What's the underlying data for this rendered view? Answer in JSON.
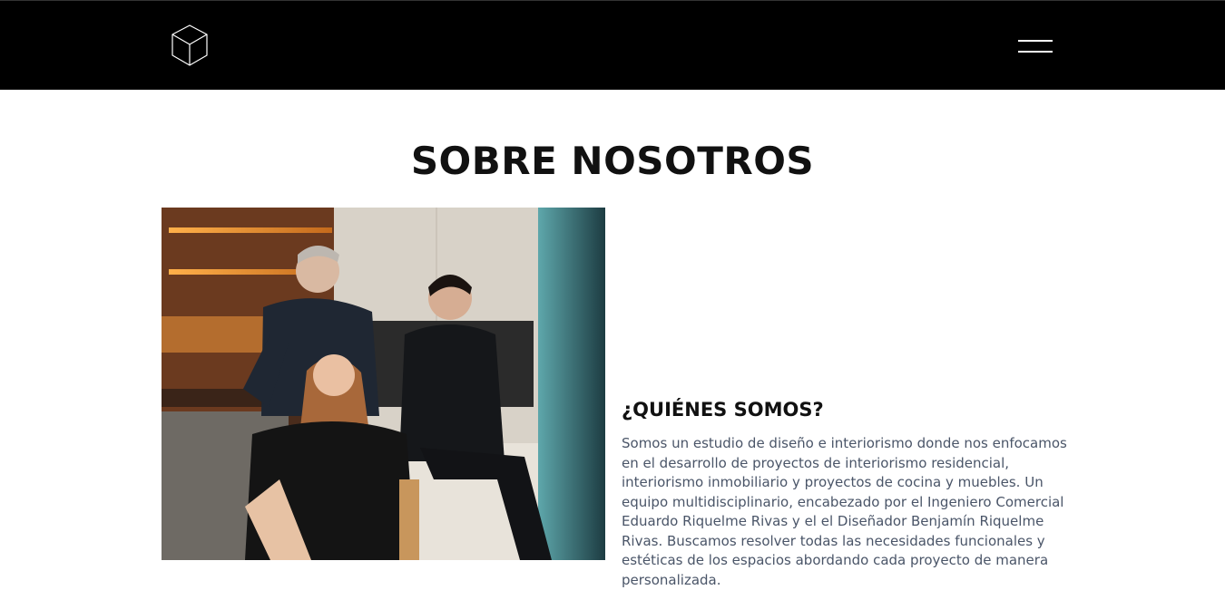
{
  "header": {
    "logo_icon": "cube-outline-icon",
    "menu_icon": "hamburger-menu-icon",
    "background_color": "#000000"
  },
  "page": {
    "title": "SOBRE NOSOTROS"
  },
  "about": {
    "photo_alt": "Equipo del estudio",
    "heading": "¿QUIÉNES SOMOS?",
    "text": "Somos un estudio de diseño e interiorismo donde nos enfocamos en el desarrollo de proyectos de interiorismo residencial, interiorismo inmobiliario y proyectos de cocina y muebles. Un equipo multidisciplinario, encabezado por el Ingeniero Comercial Eduardo Riquelme Rivas y el el Diseñador Benjamín Riquelme Rivas. Buscamos resolver todas las necesidades funcionales y estéticas de los espacios abordando cada proyecto de manera personalizada."
  },
  "colors": {
    "header_bg": "#000000",
    "title_text": "#111111",
    "body_text": "#4a5568"
  }
}
